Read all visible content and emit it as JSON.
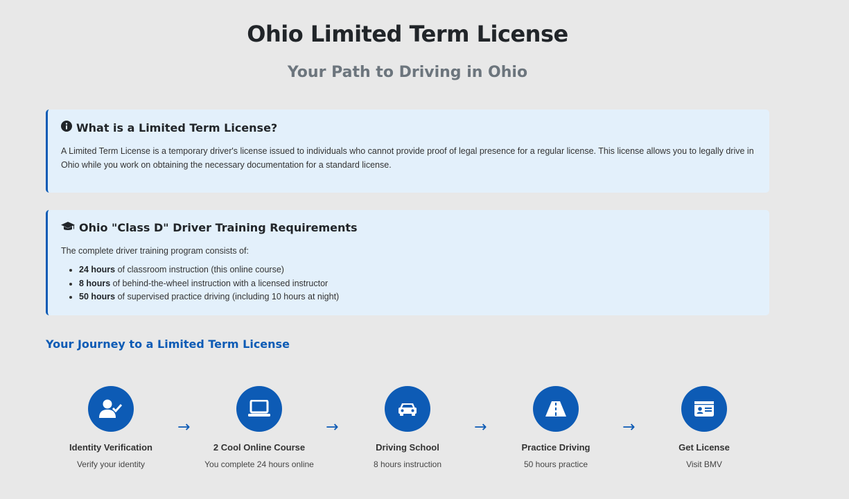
{
  "header": {
    "title": "Ohio Limited Term License",
    "subtitle": "Your Path to Driving in Ohio"
  },
  "info_card": {
    "icon": "info-circle-icon",
    "heading": "What is a Limited Term License?",
    "text": "A Limited Term License is a temporary driver's license issued to individuals who cannot provide proof of legal presence for a regular license. This license allows you to legally drive in Ohio while you work on obtaining the necessary documentation for a standard license."
  },
  "requirements_card": {
    "icon": "graduation-cap-icon",
    "heading": "Ohio \"Class D\" Driver Training Requirements",
    "intro": "The complete driver training program consists of:",
    "items": [
      {
        "hours": "24 hours",
        "text": " of classroom instruction (this online course)"
      },
      {
        "hours": "8 hours",
        "text": " of behind-the-wheel instruction with a licensed instructor"
      },
      {
        "hours": "50 hours",
        "text": " of supervised practice driving (including 10 hours at night)"
      }
    ]
  },
  "journey": {
    "title": "Your Journey to a Limited Term License",
    "arrow": "→",
    "steps": [
      {
        "icon": "user-check-icon",
        "title": "Identity Verification",
        "desc": "Verify your identity"
      },
      {
        "icon": "laptop-icon",
        "title": "2 Cool Online Course",
        "desc": "You complete 24 hours online"
      },
      {
        "icon": "car-icon",
        "title": "Driving School",
        "desc": "8 hours instruction"
      },
      {
        "icon": "road-icon",
        "title": "Practice Driving",
        "desc": "50 hours practice"
      },
      {
        "icon": "id-card-icon",
        "title": "Get License",
        "desc": "Visit BMV"
      }
    ]
  },
  "colors": {
    "accent": "#0d5bb5",
    "card_bg": "#e3f0fb",
    "page_bg": "#e8e8e8"
  }
}
